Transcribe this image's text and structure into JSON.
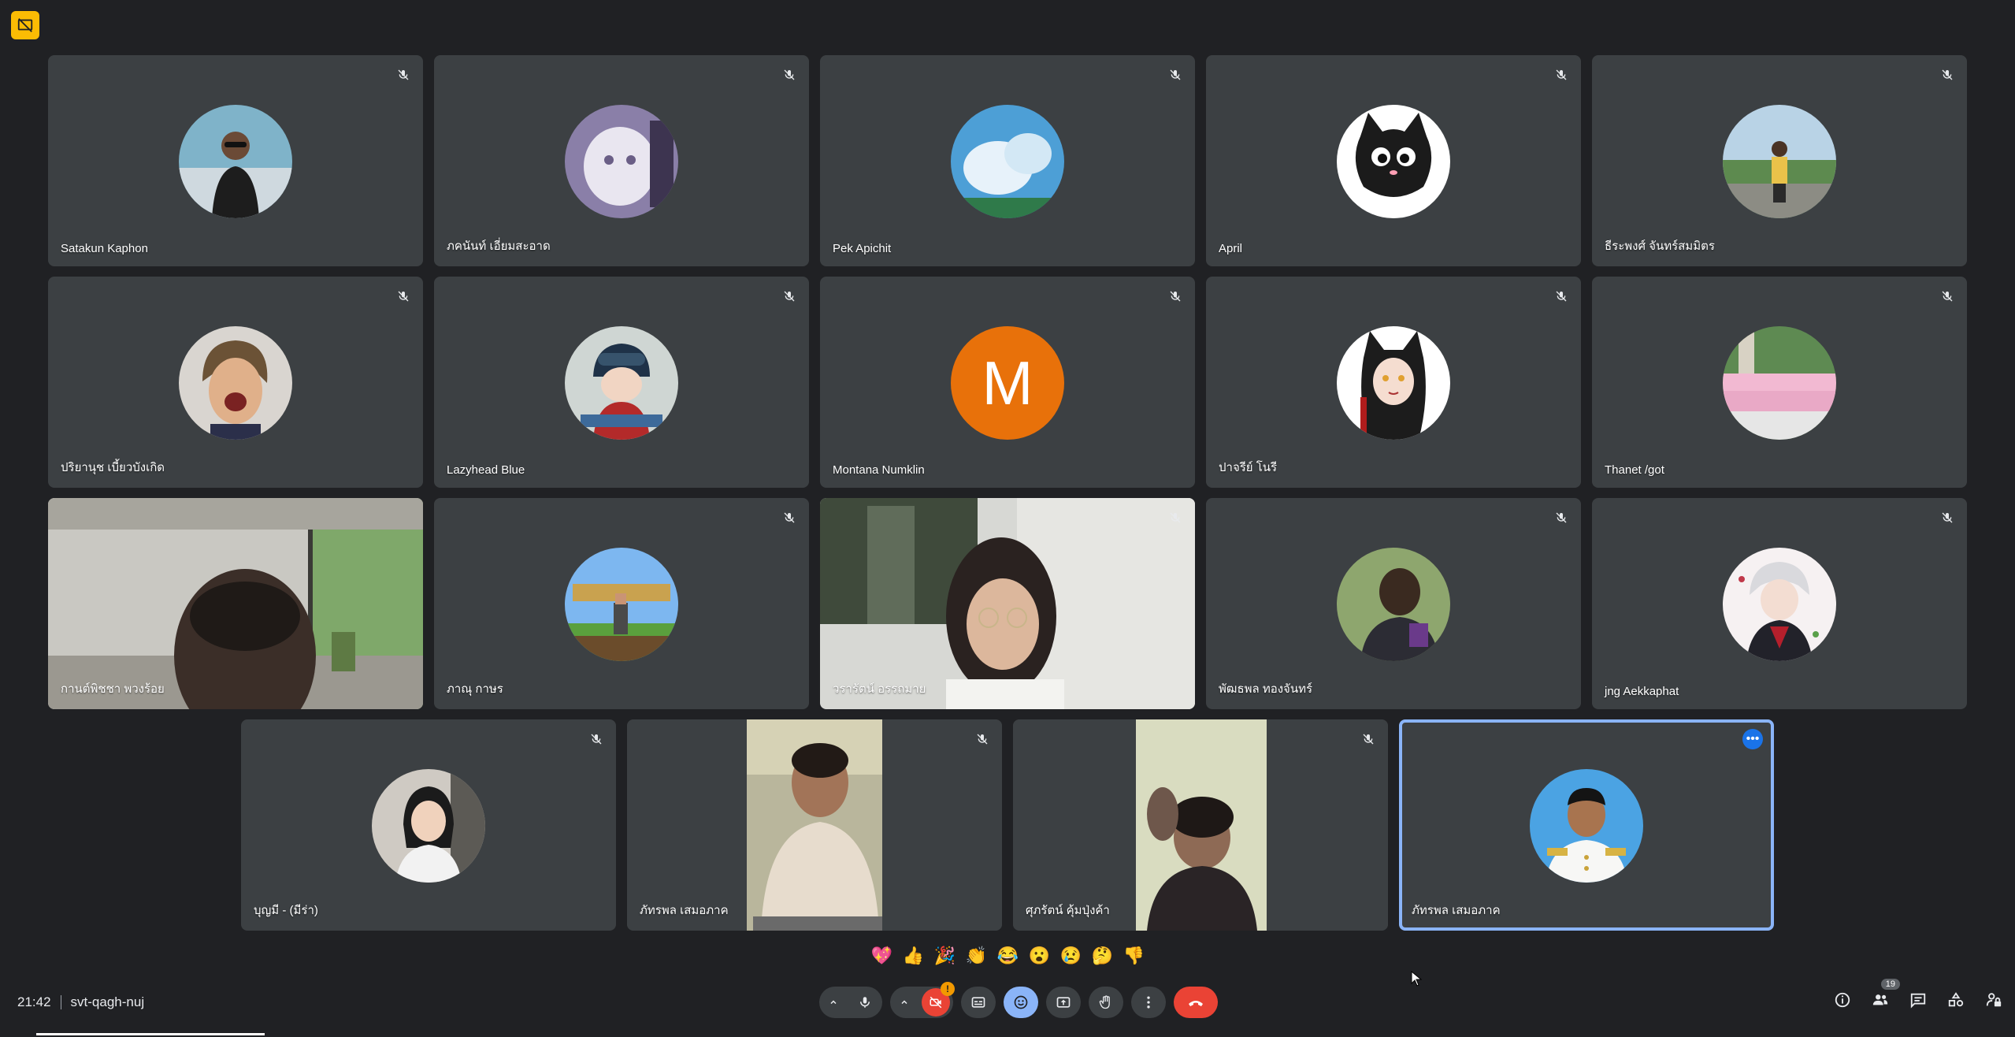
{
  "corner_icon": "present-off-icon",
  "participants_row1": [
    {
      "name": "Satakun Kaphon"
    },
    {
      "name": "ภคนันท์ เอี่ยมสะอาด"
    },
    {
      "name": "Pek Apichit"
    },
    {
      "name": "April"
    },
    {
      "name": "ธีระพงศ์ จันทร์สมมิตร"
    }
  ],
  "participants_row2": [
    {
      "name": "ปริยานุช เบี้ยวบังเกิด"
    },
    {
      "name": "Lazyhead Blue"
    },
    {
      "name": "Montana Numklin",
      "initial": "M"
    },
    {
      "name": "ปาจรีย์ โนรี"
    },
    {
      "name": "Thanet /got"
    }
  ],
  "participants_row3": [
    {
      "name": "กานต์พิชชา พวงร้อย"
    },
    {
      "name": "ภาณุ กาษร"
    },
    {
      "name": "วรารัตน์ อรรถมาย"
    },
    {
      "name": "พัฒธพล ทองจันทร์"
    },
    {
      "name": "jng Aekkaphat"
    }
  ],
  "participants_row4": [
    {
      "name": "บุญมี - (มีร่า)"
    },
    {
      "name": "ภัทรพล เสมอภาค"
    },
    {
      "name": "ศุภรัตน์ คุ้มปุ่งค้า"
    },
    {
      "name": "ภัทรพล เสมอภาค"
    }
  ],
  "reactions": [
    "💖",
    "👍",
    "🎉",
    "👏",
    "😂",
    "😮",
    "😢",
    "🤔",
    "👎"
  ],
  "meeting": {
    "time": "21:42",
    "code": "svt-qagh-nuj"
  },
  "controls": {
    "camera_warning": "!",
    "people_count": "19"
  },
  "colors": {
    "background": "#202124",
    "tile": "#3c4043",
    "active_border": "#8ab4f8",
    "hangup": "#ea4335",
    "badge_yellow": "#fbbc04",
    "avatar_letter_bg": "#e8710a"
  }
}
